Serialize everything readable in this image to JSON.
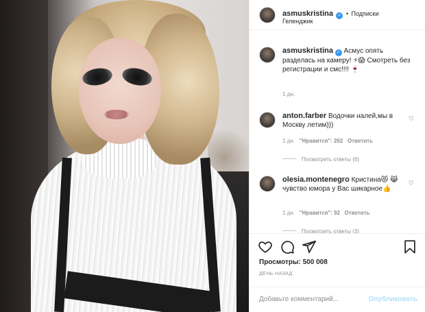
{
  "header": {
    "username": "asmuskristina",
    "separator": "•",
    "follow_label": "Подписки",
    "location": "Геленджик"
  },
  "caption": {
    "username": "asmuskristina",
    "text": "Асмус опять разделась на камеру! ⚡😱 Смотреть без регистрации и смс!!!! 🍷",
    "time": "1 дн."
  },
  "comments": [
    {
      "username": "anton.farber",
      "text": "Водочки налей,мы в Москву летим)))",
      "time": "1 дн.",
      "likes": "\"Нравится\": 262",
      "reply_label": "Ответить",
      "view_replies": "Посмотреть ответы (6)"
    },
    {
      "username": "olesia.montenegro",
      "text": "Кристина😻 😹 чувство юмора у Вас шикарное👍",
      "time": "1 дн.",
      "likes": "\"Нравится\": 92",
      "reply_label": "Ответить",
      "view_replies": "Посмотреть ответы (3)"
    }
  ],
  "post": {
    "views": "Просмотры: 500 008",
    "time_ago": "ДЕНЬ НАЗАД"
  },
  "comment_input": {
    "placeholder": "Добавьте комментарий...",
    "post_label": "Опубликовать"
  },
  "colors": {
    "link_blue": "#3897f0",
    "post_disabled": "#b2dffc",
    "secondary_text": "#8e8e8e"
  }
}
